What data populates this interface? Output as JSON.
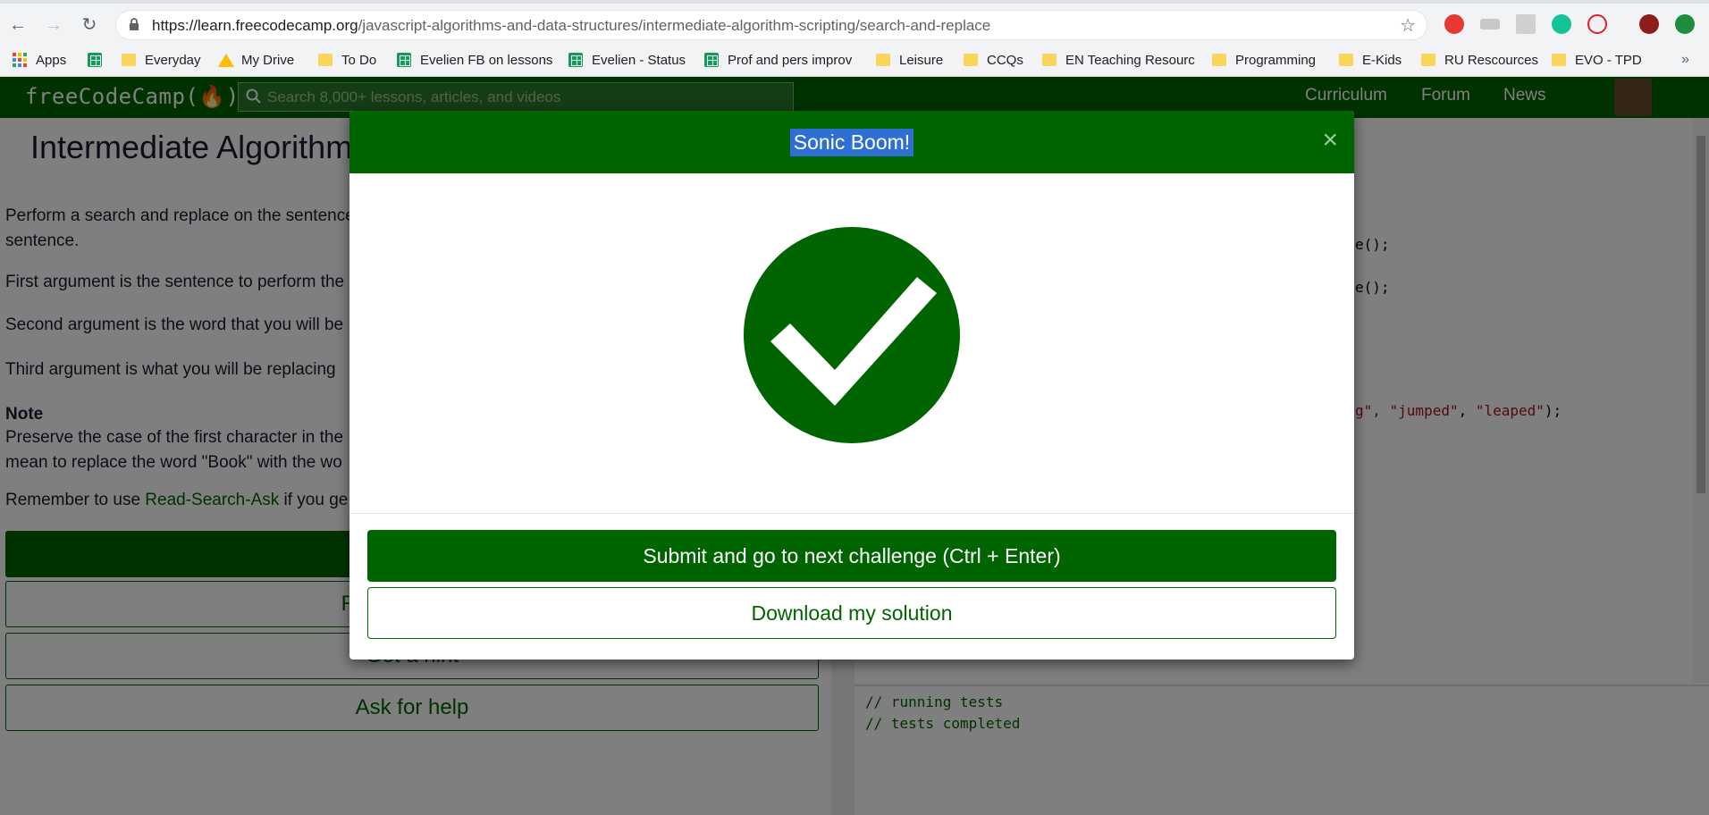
{
  "browser": {
    "url_host": "https://learn.freecodecamp.org",
    "url_path": "/javascript-algorithms-and-data-structures/intermediate-algorithm-scripting/search-and-replace",
    "bookmarks": [
      {
        "label": "Apps",
        "icon": "apps-icon"
      },
      {
        "label": "Everyday",
        "icon": "folder-icon"
      },
      {
        "label": "My Drive",
        "icon": "google-drive-icon"
      },
      {
        "label": "To Do",
        "icon": "folder-icon"
      },
      {
        "label": "Evelien FB on lessons",
        "icon": "sheets-icon"
      },
      {
        "label": "Evelien - Status",
        "icon": "sheets-icon"
      },
      {
        "label": "Prof and pers improv",
        "icon": "sheets-icon"
      },
      {
        "label": "Leisure",
        "icon": "folder-icon"
      },
      {
        "label": "CCQs",
        "icon": "folder-icon"
      },
      {
        "label": "EN Teaching Resourc",
        "icon": "folder-icon"
      },
      {
        "label": "Programming",
        "icon": "folder-icon"
      },
      {
        "label": "E-Kids",
        "icon": "folder-icon"
      },
      {
        "label": "RU Rescources",
        "icon": "folder-icon"
      },
      {
        "label": "EVO - TPD",
        "icon": "folder-icon"
      }
    ],
    "more_bookmarks": "»"
  },
  "fcc_nav": {
    "logo": "freeCodeCamp(🔥)",
    "search_placeholder": "Search 8,000+ lessons, articles, and videos",
    "links": [
      "Curriculum",
      "Forum",
      "News"
    ]
  },
  "challenge": {
    "title": "Intermediate Algorithm",
    "p1": "Perform a search and replace on the sentence",
    "p1b": "sentence.",
    "p2": "First argument is the sentence to perform the",
    "p3": "Second argument is the word that you will be",
    "p4": "Third argument is what you will be replacing",
    "note_title": "Note",
    "note_l1": "Preserve the case of the first character in the",
    "note_l2": "mean to replace the word \"Book\" with the wo",
    "remember_pre": "Remember to use ",
    "remember_link": "Read-Search-Ask",
    "remember_post": " if you ge",
    "buttons": {
      "reset": "Reset All Code",
      "hint": "Get a hint",
      "help": "Ask for help"
    }
  },
  "editor": {
    "line1": "e();",
    "line2": "e();",
    "line3_a": "g\", ",
    "line3_b": "\"jumped\"",
    "line3_c": ", ",
    "line3_d": "\"leaped\"",
    "line3_e": ");"
  },
  "console": {
    "lines": [
      "// running tests",
      "// tests completed"
    ]
  },
  "modal": {
    "title": "Sonic Boom!",
    "close": "×",
    "submit_label": "Submit and go to next challenge (Ctrl + Enter)",
    "download_label": "Download my solution"
  },
  "colors": {
    "fcc_green": "#006400",
    "selection_blue": "#2e6fd3"
  }
}
